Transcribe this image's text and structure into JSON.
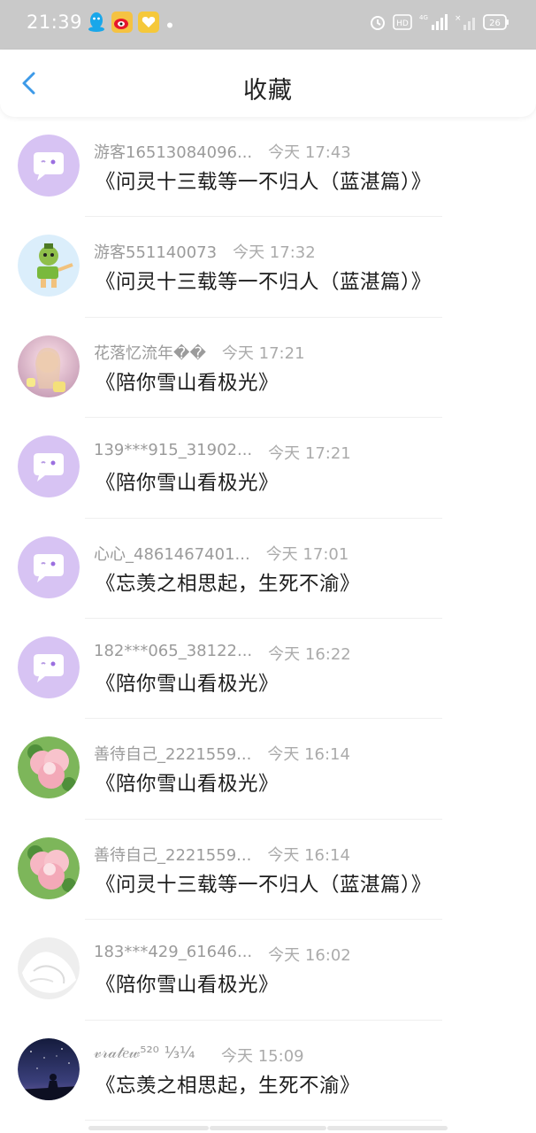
{
  "status_bar": {
    "time": "21:39",
    "notification_icons": [
      "qq-icon",
      "weibo-icon",
      "heart-app-icon",
      "dot-icon"
    ],
    "right_icons": [
      "alarm-icon",
      "hd-icon",
      "signal-4g-icon",
      "signal-off-icon"
    ],
    "battery": "26"
  },
  "header": {
    "title": "收藏",
    "back_icon": "chevron-left-icon",
    "accent_color": "#3d9ae8"
  },
  "favorites": [
    {
      "user": "游客16513084096...",
      "time": "今天 17:43",
      "book": "《问灵十三载等一不归人（蓝湛篇）》",
      "avatar": "default-chat-avatar"
    },
    {
      "user": "游客551140073",
      "time": "今天 17:32",
      "book": "《问灵十三载等一不归人（蓝湛篇）》",
      "avatar": "cartoon-avatar"
    },
    {
      "user": "花落忆流年��",
      "time": "今天 17:21",
      "book": "《陪你雪山看极光》",
      "avatar": "girl-photo-avatar"
    },
    {
      "user": "139***915_31902...",
      "time": "今天 17:21",
      "book": "《陪你雪山看极光》",
      "avatar": "default-chat-avatar"
    },
    {
      "user": "心心_4861467401...",
      "time": "今天 17:01",
      "book": "《忘羡之相思起，生死不渝》",
      "avatar": "default-chat-avatar"
    },
    {
      "user": "182***065_38122...",
      "time": "今天 16:22",
      "book": "《陪你雪山看极光》",
      "avatar": "default-chat-avatar"
    },
    {
      "user": "善待自己_2221559...",
      "time": "今天 16:14",
      "book": "《陪你雪山看极光》",
      "avatar": "flower-photo-avatar"
    },
    {
      "user": "善待自己_2221559...",
      "time": "今天 16:14",
      "book": "《问灵十三载等一不归人（蓝湛篇）》",
      "avatar": "flower-photo-avatar"
    },
    {
      "user": "183***429_61646...",
      "time": "今天 16:02",
      "book": "《陪你雪山看极光》",
      "avatar": "white-fabric-avatar"
    },
    {
      "user": "𝓋𝓇𝒶𝓉𝑒𝓌⁵²⁰ ⅓¼",
      "time": "今天 15:09",
      "book": "《忘羡之相思起，生死不渝》",
      "avatar": "night-sky-avatar"
    }
  ]
}
